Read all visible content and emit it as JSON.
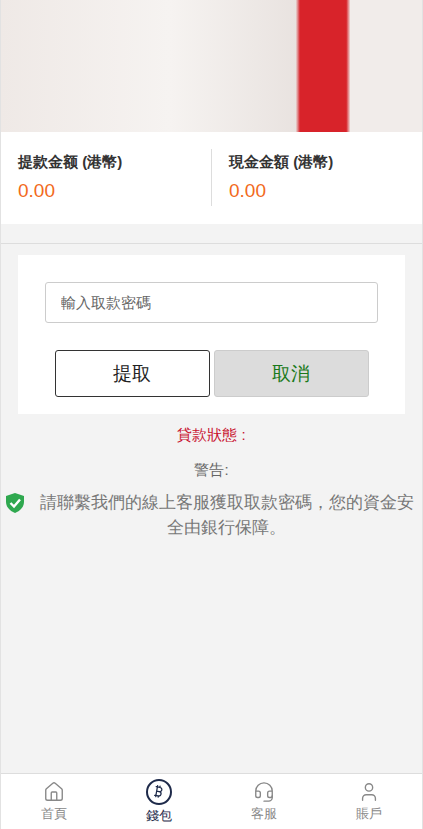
{
  "amounts": [
    {
      "label": "提款金额 (港幣)",
      "value": "0.00"
    },
    {
      "label": "現金金額 (港幣)",
      "value": "0.00"
    }
  ],
  "form": {
    "placeholder": "輸入取款密碼",
    "buttons": [
      {
        "label": "提取",
        "kind": "primary"
      },
      {
        "label": "取消",
        "kind": "secondary"
      }
    ]
  },
  "loan_status": "貸款狀態 :",
  "warning_title": "警告:",
  "notice": "請聯繫我們的線上客服獲取取款密碼，您的資金安全由銀行保障。",
  "nav": [
    {
      "label": "首頁",
      "selected": false,
      "kind": "home"
    },
    {
      "label": "錢包",
      "selected": true,
      "kind": "wallet"
    },
    {
      "label": "客服",
      "selected": false,
      "kind": "service"
    },
    {
      "label": "賬戶",
      "selected": false,
      "kind": "account"
    }
  ]
}
